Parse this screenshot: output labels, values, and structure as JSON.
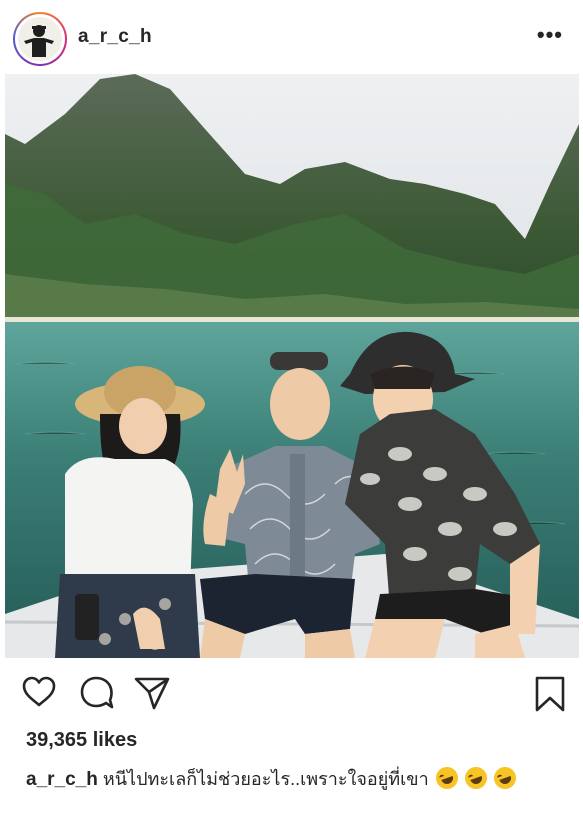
{
  "post": {
    "username": "a_r_c_h",
    "more_label": "•••",
    "likes": "39,365 likes",
    "caption_user": "a_r_c_h",
    "caption_text": "หนีไปทะเลก็ไม่ช่วยอะไร..เพราะใจอยู่ที่เขา"
  },
  "icons": {
    "avatar": "avatar",
    "like": "heart-icon",
    "comment": "comment-icon",
    "share": "send-icon",
    "save": "bookmark-icon",
    "emoji": "rofl-emoji"
  },
  "colors": {
    "text": "#262626",
    "sea": "#2f6f68",
    "sky": "#e8ebee",
    "mountain": "#3d5a3a"
  }
}
